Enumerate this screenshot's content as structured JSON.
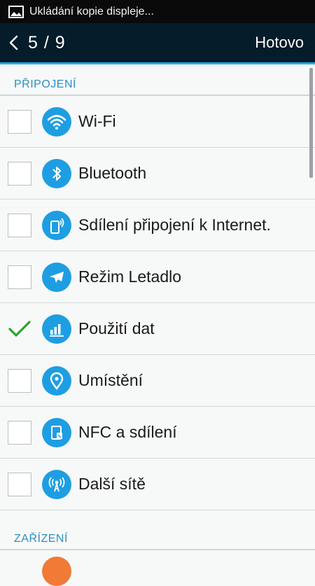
{
  "status_bar": {
    "text": "Ukládání kopie displeje..."
  },
  "header": {
    "counter": "5 / 9",
    "done_label": "Hotovo"
  },
  "sections": {
    "connections": "PŘIPOJENÍ",
    "device": "ZAŘÍZENÍ"
  },
  "items": [
    {
      "label": "Wi-Fi",
      "icon": "wifi-icon",
      "checked": false
    },
    {
      "label": "Bluetooth",
      "icon": "bluetooth-icon",
      "checked": false
    },
    {
      "label": "Sdílení připojení k Internet.",
      "icon": "tethering-icon",
      "checked": false
    },
    {
      "label": "Režim Letadlo",
      "icon": "airplane-icon",
      "checked": false
    },
    {
      "label": "Použití dat",
      "icon": "data-usage-icon",
      "checked": true
    },
    {
      "label": "Umístění",
      "icon": "location-icon",
      "checked": false
    },
    {
      "label": "NFC a sdílení",
      "icon": "nfc-icon",
      "checked": false
    },
    {
      "label": "Další sítě",
      "icon": "more-networks-icon",
      "checked": false
    }
  ],
  "colors": {
    "accent": "#1ea9e8",
    "icon_bg": "#1e9ee2",
    "check": "#2aa52a",
    "section": "#2e8fc0"
  }
}
